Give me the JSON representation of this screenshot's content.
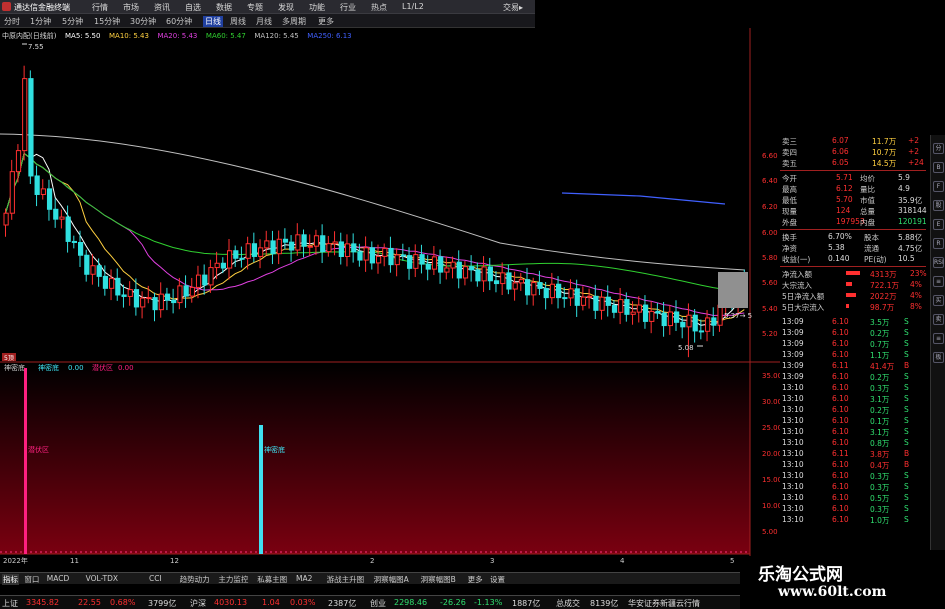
{
  "menubar": {
    "app_title": "通达信金融终端",
    "items": [
      "行情",
      "市场",
      "资讯",
      "自选",
      "数据",
      "专题",
      "发现",
      "功能",
      "行业",
      "热点",
      "L1/L2"
    ],
    "trade": "交易▸"
  },
  "periodbar": {
    "items": [
      "分时",
      "1分钟",
      "5分钟",
      "15分钟",
      "30分钟",
      "60分钟",
      "日线",
      "周线",
      "月线",
      "多周期",
      "更多"
    ],
    "active_index": 6
  },
  "ma_legend": {
    "stock": "中原内配(日线前)",
    "items": [
      {
        "label": "MA5: 5.50",
        "color": "#ffffff"
      },
      {
        "label": "MA10: 5.43",
        "color": "#ffd040"
      },
      {
        "label": "MA20: 5.43",
        "color": "#e040e0"
      },
      {
        "label": "MA60: 5.47",
        "color": "#30d030"
      },
      {
        "label": "MA120: 5.45",
        "color": "#c0c0c0"
      },
      {
        "label": "MA250: 6.13",
        "color": "#4060ff"
      }
    ]
  },
  "kline": {
    "high_label": "7.55",
    "low_label": "5.08",
    "right_label": "5.37→ 5"
  },
  "price_axis": {
    "ticks": [
      "6.60",
      "6.40",
      "6.20",
      "6.00",
      "5.80",
      "5.60",
      "5.40",
      "5.20"
    ]
  },
  "indicator": {
    "tag": "5顶",
    "name": "神密底",
    "v1_label": "神密底",
    "v1_value": "0.00",
    "v2_label": "潜伏区",
    "v2_value": "0.00",
    "bar1_label": "潜伏区",
    "bar2_label": "神密底",
    "axis_ticks": [
      "35.00",
      "30.00",
      "25.00",
      "20.00",
      "15.00",
      "10.00",
      "5.00"
    ]
  },
  "date_axis": {
    "labels": [
      "2022年",
      "11",
      "12",
      "2",
      "3",
      "4",
      "5"
    ],
    "right_label": "模板"
  },
  "quote": {
    "asks": [
      {
        "label": "卖三",
        "price": "6.07",
        "vol": "11.7万",
        "chg": "+2"
      },
      {
        "label": "卖四",
        "price": "6.06",
        "vol": "10.7万",
        "chg": "+2"
      },
      {
        "label": "卖五",
        "price": "6.05",
        "vol": "14.5万",
        "chg": "+24"
      }
    ],
    "stats": [
      {
        "l1": "今开",
        "v1": "5.71",
        "l2": "均价",
        "v2": "5.9"
      },
      {
        "l1": "最高",
        "v1": "6.12",
        "l2": "量比",
        "v2": "4.9"
      },
      {
        "l1": "最低",
        "v1": "5.70",
        "l2": "市值",
        "v2": "35.9亿"
      },
      {
        "l1": "现量",
        "v1": "124",
        "l2": "总量",
        "v2": "318144"
      },
      {
        "l1": "外盘",
        "v1": "197953",
        "l2": "内盘",
        "v2": "120191"
      }
    ],
    "stats2": [
      {
        "l1": "换手",
        "v1": "6.70%",
        "l2": "股本",
        "v2": "5.88亿"
      },
      {
        "l1": "净资",
        "v1": "5.38",
        "l2": "流通",
        "v2": "4.75亿"
      },
      {
        "l1": "收益(一)",
        "v1": "0.140",
        "l2": "PE(动)",
        "v2": "10.5"
      }
    ],
    "flows": [
      {
        "label": "净流入额",
        "value": "4313万",
        "pct": "23%"
      },
      {
        "label": "大宗流入",
        "value": "722.1万",
        "pct": "4%"
      },
      {
        "label": "5日净流入额",
        "value": "2022万",
        "pct": "4%"
      },
      {
        "label": "5日大宗流入",
        "value": "98.7万",
        "pct": "8%"
      }
    ]
  },
  "ticks": [
    {
      "time": "13:09",
      "price": "6.10",
      "vol": "3.5万",
      "side": "S"
    },
    {
      "time": "13:09",
      "price": "6.10",
      "vol": "0.2万",
      "side": "S"
    },
    {
      "time": "13:09",
      "price": "6.10",
      "vol": "0.7万",
      "side": "S"
    },
    {
      "time": "13:09",
      "price": "6.10",
      "vol": "1.1万",
      "side": "S"
    },
    {
      "time": "13:09",
      "price": "6.11",
      "vol": "41.4万",
      "side": "B"
    },
    {
      "time": "13:09",
      "price": "6.10",
      "vol": "0.2万",
      "side": "S"
    },
    {
      "time": "13:10",
      "price": "6.10",
      "vol": "0.3万",
      "side": "S"
    },
    {
      "time": "13:10",
      "price": "6.10",
      "vol": "3.1万",
      "side": "S"
    },
    {
      "time": "13:10",
      "price": "6.10",
      "vol": "0.2万",
      "side": "S"
    },
    {
      "time": "13:10",
      "price": "6.10",
      "vol": "0.1万",
      "side": "S"
    },
    {
      "time": "13:10",
      "price": "6.10",
      "vol": "3.1万",
      "side": "S"
    },
    {
      "time": "13:10",
      "price": "6.10",
      "vol": "0.8万",
      "side": "S"
    },
    {
      "time": "13:10",
      "price": "6.11",
      "vol": "3.8万",
      "side": "B"
    },
    {
      "time": "13:10",
      "price": "6.10",
      "vol": "0.4万",
      "side": "B"
    },
    {
      "time": "13:10",
      "price": "6.10",
      "vol": "0.3万",
      "side": "S"
    },
    {
      "time": "13:10",
      "price": "6.10",
      "vol": "0.3万",
      "side": "S"
    },
    {
      "time": "13:10",
      "price": "6.10",
      "vol": "0.5万",
      "side": "S"
    },
    {
      "time": "13:10",
      "price": "6.10",
      "vol": "0.3万",
      "side": "S"
    },
    {
      "time": "13:10",
      "price": "6.10",
      "vol": "1.0万",
      "side": "S"
    }
  ],
  "tabs": {
    "items": [
      "指标",
      "窗口",
      "MACD",
      "VOL-TDX",
      "CCI",
      "趋势动力",
      "主力监控",
      "私募主图",
      "MA2",
      "游战主升图",
      "洞察幅图A",
      "洞察幅图B",
      "更多",
      "设置"
    ],
    "active_index": 0
  },
  "side_icons": [
    "分",
    "B",
    "F",
    "股",
    "E",
    "R",
    "RSI",
    "≡",
    "买",
    "卖",
    "≡",
    "板"
  ],
  "statusbar": {
    "sh_label": "上证",
    "sh_value": "3345.82",
    "sh_chg": "22.55",
    "sh_pct": "0.68%",
    "sh_amt": "3799亿",
    "sz_label": "沪深",
    "sz_value": "4030.13",
    "sz_chg": "1.04",
    "sz_pct": "0.03%",
    "sz_amt": "2387亿",
    "cy_label": "创业",
    "cy_value": "2298.46",
    "cy_chg": "-26.26",
    "cy_pct": "-1.13%",
    "cy_amt": "1887亿",
    "total_label": "总成交",
    "total_value": "8139亿",
    "news": "华安证券新疆云行情"
  },
  "watermark": {
    "title": "乐淘公式网",
    "url": "www.60lt.com"
  },
  "colors": {
    "up": "#ff3030",
    "down": "#30e0e0",
    "ma5": "#ffffff",
    "ma10": "#ffd040",
    "ma20": "#e040e0",
    "ma60": "#30d030",
    "ma120": "#c0c0c0",
    "ma250": "#4060ff",
    "pink_bar": "#ff2080",
    "cyan_bar": "#40e0f0"
  }
}
